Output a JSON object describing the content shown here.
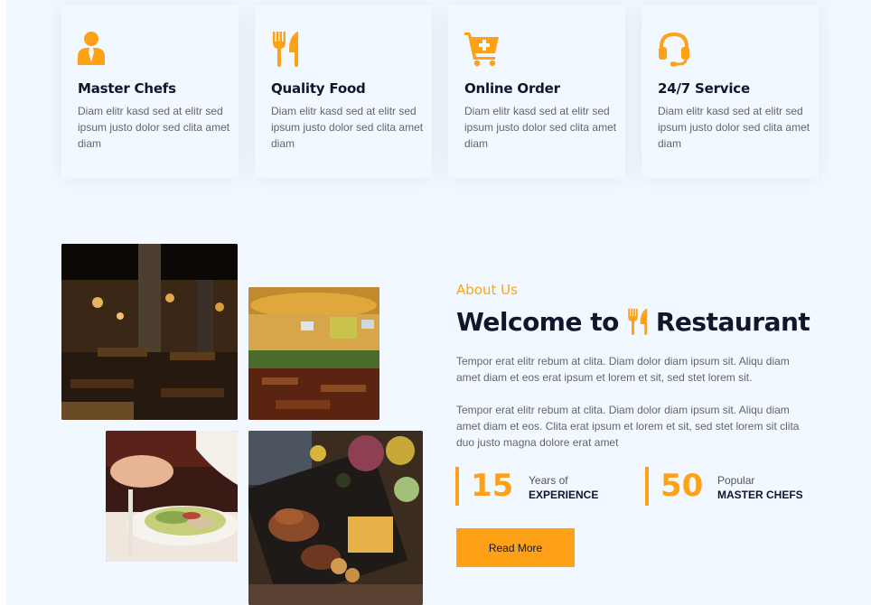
{
  "theme": {
    "accent": "#fea116",
    "dark": "#0f172b",
    "background": "#f1f8ff",
    "muted_text": "#666565"
  },
  "services": [
    {
      "icon": "user-tie-icon",
      "title": "Master Chefs",
      "text": "Diam elitr kasd sed at elitr sed ipsum justo dolor sed clita amet diam"
    },
    {
      "icon": "utensils-icon",
      "title": "Quality Food",
      "text": "Diam elitr kasd sed at elitr sed ipsum justo dolor sed clita amet diam"
    },
    {
      "icon": "cart-plus-icon",
      "title": "Online Order",
      "text": "Diam elitr kasd sed at elitr sed ipsum justo dolor sed clita amet diam"
    },
    {
      "icon": "headset-icon",
      "title": "24/7 Service",
      "text": "Diam elitr kasd sed at elitr sed ipsum justo dolor sed clita amet diam"
    }
  ],
  "about": {
    "label": "About Us",
    "title_pre": "Welcome to",
    "title_icon": "utensils-icon",
    "title_post": "Restaurant",
    "paragraph1": "Tempor erat elitr rebum at clita. Diam dolor diam ipsum sit. Aliqu diam amet diam et eos erat ipsum et lorem et sit, sed stet lorem sit.",
    "paragraph2": "Tempor erat elitr rebum at clita. Diam dolor diam ipsum sit. Aliqu diam amet diam et eos. Clita erat ipsum et lorem et sit, sed stet lorem sit clita duo justo magna dolore erat amet",
    "stats": [
      {
        "number": "15",
        "label_top": "Years of",
        "label_bottom": "EXPERIENCE"
      },
      {
        "number": "50",
        "label_top": "Popular",
        "label_bottom": "MASTER CHEFS"
      }
    ],
    "button_label": "Read More"
  }
}
